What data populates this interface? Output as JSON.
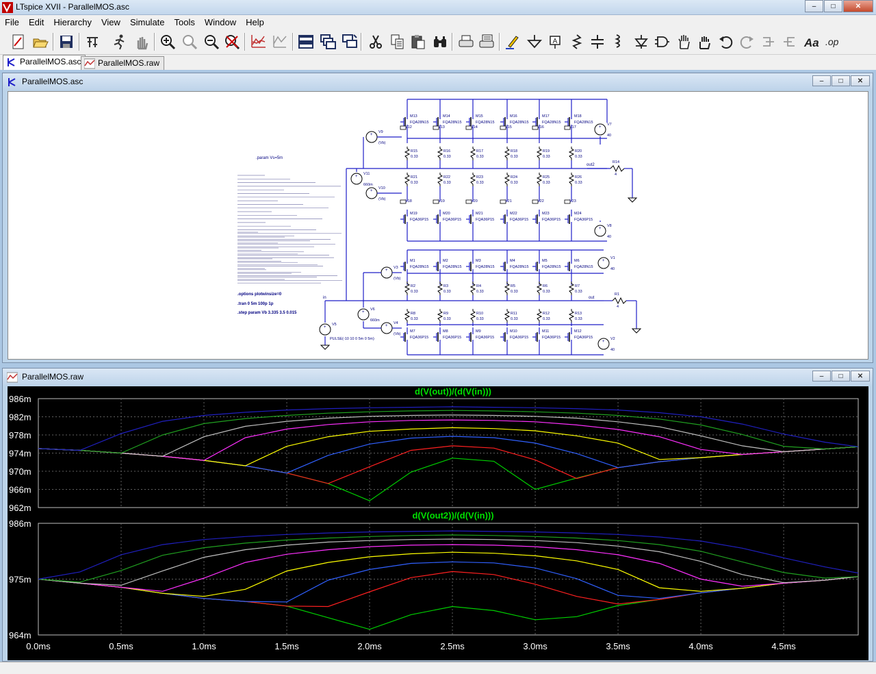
{
  "app": {
    "title": "LTspice XVII - ParallelMOS.asc",
    "min_glyph": "–",
    "max_glyph": "□",
    "close_glyph": "✕"
  },
  "menu": [
    {
      "label": "File"
    },
    {
      "label": "Edit"
    },
    {
      "label": "Hierarchy"
    },
    {
      "label": "View"
    },
    {
      "label": "Simulate"
    },
    {
      "label": "Tools"
    },
    {
      "label": "Window"
    },
    {
      "label": "Help"
    }
  ],
  "toolbar_icons": [
    "new-schematic-icon",
    "open-icon",
    "save-icon",
    "control-panel-icon",
    "run-icon",
    "halt-icon",
    "zoom-in-icon",
    "zoom-full-icon",
    "zoom-out-icon",
    "autorange-icon",
    "plot-settings-icon",
    "graph-icon",
    "tile-horizontal-icon",
    "cascade-icon",
    "tile-vertical-icon",
    "cut-icon",
    "copy-icon",
    "paste-icon",
    "find-icon",
    "print-icon",
    "print-preview-icon",
    "draw-wire-icon",
    "ground-icon",
    "label-net-icon",
    "resistor-icon",
    "capacitor-icon",
    "inductor-icon",
    "diode-icon",
    "component-icon",
    "move-icon",
    "drag-icon",
    "undo-icon",
    "redo-icon",
    "rotate-icon",
    "mirror-icon",
    "text-icon",
    "spice-directive-icon"
  ],
  "doctabs": [
    {
      "label": "ParallelMOS.asc",
      "active": true
    },
    {
      "label": "ParallelMOS.raw",
      "active": false
    }
  ],
  "schematic_window": {
    "title": "ParallelMOS.asc",
    "directives": {
      "param": ".param Vs=5m",
      "options": ".options plotwinsize=0",
      "tran": ".tran 0 5m 100p 1p",
      "step": ".step param Vb 3.335 3.5 0.015"
    },
    "net_labels": {
      "out": "out",
      "out2": "out2",
      "in": "in"
    },
    "pulse": "PULSE(-10 10 0 5m 0 5m)",
    "model": "FQA28N15",
    "model_upper": "FQA28N15",
    "model_lower": "FQA36P15",
    "bias_value": "660m",
    "vb": "(Vb)",
    "v40": "40",
    "r_value": "0.33",
    "load": "4"
  },
  "waveform_window": {
    "title": "ParallelMOS.raw",
    "pane1_title": "d(V(out))/(d(V(in)))",
    "pane2_title": "d(V(out2))/(d(V(in)))",
    "pane1_yticks": [
      "986m",
      "982m",
      "978m",
      "974m",
      "970m",
      "966m",
      "962m"
    ],
    "pane2_yticks": [
      "986m",
      "975m",
      "964m"
    ],
    "xticks": [
      "0.0ms",
      "0.5ms",
      "1.0ms",
      "1.5ms",
      "2.0ms",
      "2.5ms",
      "3.0ms",
      "3.5ms",
      "4.0ms",
      "4.5ms"
    ]
  },
  "colors": {
    "trace_title": "#00e000",
    "axis_text": "#ffffff",
    "grid": "#606060",
    "schematic_wire": "#1e1ec8",
    "schematic_text": "#000080",
    "series": [
      "#00d000",
      "#ff2020",
      "#3060ff",
      "#ffff00",
      "#ff30ff",
      "#c0c0c0",
      "#20a020",
      "#2020c0"
    ]
  },
  "chart_data": [
    {
      "type": "line",
      "title": "d(V(out))/(d(V(in)))",
      "xlabel": "",
      "ylabel": "",
      "xlim": [
        0,
        4.95
      ],
      "ylim": [
        962,
        986
      ],
      "x_unit": "ms",
      "y_unit": "m",
      "grid": true,
      "x": [
        0.0,
        0.25,
        0.5,
        0.75,
        1.0,
        1.25,
        1.5,
        1.75,
        2.0,
        2.25,
        2.5,
        2.75,
        3.0,
        3.25,
        3.5,
        3.75,
        4.0,
        4.25,
        4.5,
        4.75,
        4.95
      ],
      "series": [
        {
          "values": [
            975.0,
            974.6,
            974.0,
            973.3,
            972.4,
            971.2,
            969.6,
            967.3,
            963.5,
            969.8,
            972.9,
            972.2,
            966.0,
            968.5,
            970.8,
            972.1,
            973.0,
            973.7,
            974.3,
            974.9,
            975.4
          ]
        },
        {
          "values": [
            975.0,
            974.6,
            974.0,
            973.3,
            972.4,
            971.2,
            969.6,
            967.3,
            971.0,
            974.6,
            975.6,
            975.1,
            972.5,
            968.4,
            970.8,
            972.1,
            973.0,
            973.7,
            974.3,
            974.9,
            975.4
          ]
        },
        {
          "values": [
            975.0,
            974.6,
            974.0,
            973.3,
            972.4,
            971.2,
            969.6,
            973.5,
            976.0,
            977.3,
            977.7,
            977.4,
            976.2,
            973.9,
            970.8,
            972.1,
            973.0,
            973.7,
            974.3,
            974.9,
            975.4
          ]
        },
        {
          "values": [
            975.0,
            974.6,
            974.0,
            973.3,
            972.4,
            971.2,
            975.5,
            977.6,
            978.8,
            979.3,
            979.6,
            979.4,
            978.9,
            977.8,
            976.2,
            972.6,
            973.0,
            973.7,
            974.3,
            974.9,
            975.4
          ]
        },
        {
          "values": [
            975.0,
            974.6,
            974.0,
            973.3,
            972.4,
            977.4,
            979.3,
            980.3,
            980.9,
            981.2,
            981.3,
            981.2,
            980.9,
            980.2,
            979.2,
            977.6,
            974.8,
            973.7,
            974.3,
            974.9,
            975.4
          ]
        },
        {
          "values": [
            975.0,
            974.6,
            974.0,
            973.3,
            977.6,
            979.9,
            981.0,
            981.7,
            982.1,
            982.3,
            982.4,
            982.3,
            982.1,
            981.7,
            980.9,
            979.8,
            977.8,
            975.6,
            974.3,
            974.9,
            975.4
          ]
        },
        {
          "values": [
            975.0,
            974.6,
            974.0,
            978.0,
            980.5,
            981.6,
            982.3,
            982.8,
            983.1,
            983.3,
            983.4,
            983.3,
            983.1,
            982.8,
            982.3,
            981.5,
            980.2,
            978.1,
            975.5,
            974.9,
            975.4
          ]
        },
        {
          "values": [
            975.0,
            974.6,
            978.3,
            981.0,
            982.3,
            983.0,
            983.5,
            983.8,
            984.0,
            984.1,
            984.2,
            984.1,
            984.0,
            983.8,
            983.5,
            982.9,
            982.0,
            980.4,
            978.2,
            976.4,
            975.4
          ]
        }
      ]
    },
    {
      "type": "line",
      "title": "d(V(out2))/(d(V(in)))",
      "xlabel": "",
      "ylabel": "",
      "xlim": [
        0,
        4.95
      ],
      "ylim": [
        964,
        986
      ],
      "x_unit": "ms",
      "y_unit": "m",
      "grid": true,
      "x": [
        0.0,
        0.25,
        0.5,
        0.75,
        1.0,
        1.25,
        1.5,
        1.75,
        2.0,
        2.25,
        2.5,
        2.75,
        3.0,
        3.25,
        3.5,
        3.75,
        4.0,
        4.25,
        4.5,
        4.75,
        4.95
      ],
      "series": [
        {
          "values": [
            975.0,
            974.2,
            973.4,
            972.2,
            971.2,
            970.6,
            969.7,
            967.4,
            965.1,
            968.0,
            969.6,
            968.8,
            967.0,
            967.6,
            969.8,
            971.0,
            972.3,
            973.2,
            974.2,
            974.8,
            975.5
          ]
        },
        {
          "values": [
            975.0,
            974.2,
            973.4,
            972.2,
            971.2,
            970.6,
            969.7,
            969.6,
            972.5,
            975.3,
            976.5,
            975.9,
            974.0,
            971.6,
            970.1,
            971.0,
            972.3,
            973.2,
            974.2,
            974.8,
            975.5
          ]
        },
        {
          "values": [
            975.0,
            974.2,
            973.4,
            972.2,
            971.2,
            970.6,
            970.5,
            974.8,
            976.9,
            978.1,
            978.4,
            978.2,
            977.2,
            975.1,
            971.8,
            971.2,
            972.3,
            973.2,
            974.2,
            974.8,
            975.5
          ]
        },
        {
          "values": [
            975.0,
            974.2,
            973.4,
            972.2,
            971.6,
            973.0,
            976.6,
            978.3,
            979.4,
            980.0,
            980.3,
            980.1,
            979.6,
            978.6,
            976.9,
            973.3,
            972.6,
            973.2,
            974.2,
            974.8,
            975.5
          ]
        },
        {
          "values": [
            975.0,
            974.2,
            973.4,
            972.6,
            975.2,
            978.3,
            979.9,
            980.8,
            981.4,
            981.7,
            981.8,
            981.7,
            981.4,
            980.8,
            979.8,
            978.1,
            975.0,
            973.6,
            974.2,
            974.8,
            975.5
          ]
        },
        {
          "values": [
            975.0,
            974.2,
            973.8,
            976.6,
            979.3,
            980.8,
            981.7,
            982.3,
            982.6,
            982.8,
            982.9,
            982.8,
            982.6,
            982.2,
            981.5,
            980.4,
            978.5,
            975.9,
            974.3,
            974.8,
            975.5
          ]
        },
        {
          "values": [
            975.0,
            974.4,
            976.7,
            979.7,
            981.2,
            982.1,
            982.7,
            983.1,
            983.4,
            983.6,
            983.7,
            983.6,
            983.4,
            983.1,
            982.6,
            981.8,
            980.5,
            978.4,
            976.3,
            975.2,
            975.5
          ]
        },
        {
          "values": [
            975.0,
            976.4,
            979.8,
            981.8,
            982.8,
            983.4,
            983.8,
            984.1,
            984.3,
            984.4,
            984.5,
            984.4,
            984.3,
            984.1,
            983.8,
            983.3,
            982.5,
            981.1,
            979.2,
            977.4,
            976.2
          ]
        }
      ]
    }
  ]
}
